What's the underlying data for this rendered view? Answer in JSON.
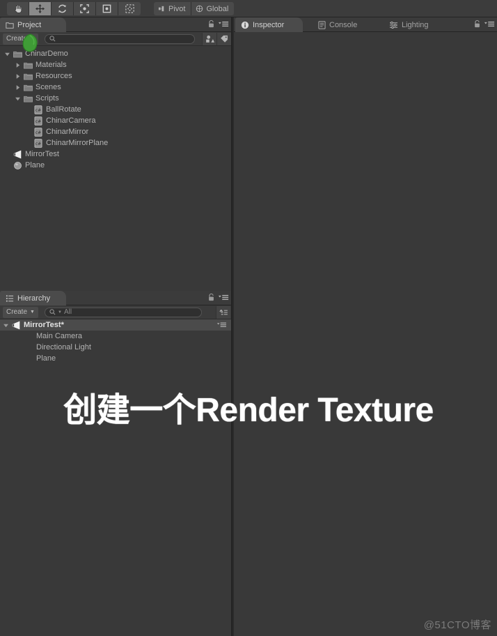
{
  "toolbar": {
    "tools": [
      {
        "name": "hand-tool",
        "icon": "hand-icon",
        "active": false
      },
      {
        "name": "move-tool",
        "icon": "move-icon",
        "active": true
      },
      {
        "name": "rotate-tool",
        "icon": "rotate-icon",
        "active": false
      },
      {
        "name": "scale-tool",
        "icon": "scale-icon",
        "active": false
      },
      {
        "name": "rect-tool",
        "icon": "rect-icon",
        "active": false
      },
      {
        "name": "transform-tool",
        "icon": "transform-icon",
        "active": false
      }
    ],
    "pivot_label": "Pivot",
    "global_label": "Global"
  },
  "project_panel": {
    "tab_label": "Project",
    "create_label": "Create",
    "search_placeholder": "",
    "tree": [
      {
        "label": "ChinarDemo",
        "depth": 0,
        "icon": "folder-icon",
        "arrow": "down",
        "selected": false
      },
      {
        "label": "Materials",
        "depth": 1,
        "icon": "folder-icon",
        "arrow": "right",
        "selected": false
      },
      {
        "label": "Resources",
        "depth": 1,
        "icon": "folder-icon",
        "arrow": "right",
        "selected": false
      },
      {
        "label": "Scenes",
        "depth": 1,
        "icon": "folder-icon",
        "arrow": "right",
        "selected": false
      },
      {
        "label": "Scripts",
        "depth": 1,
        "icon": "folder-icon",
        "arrow": "down",
        "selected": false
      },
      {
        "label": "BallRotate",
        "depth": 2,
        "icon": "csharp-script-icon",
        "arrow": "none",
        "selected": false
      },
      {
        "label": "ChinarCamera",
        "depth": 2,
        "icon": "csharp-script-icon",
        "arrow": "none",
        "selected": false
      },
      {
        "label": "ChinarMirror",
        "depth": 2,
        "icon": "csharp-script-icon",
        "arrow": "none",
        "selected": false
      },
      {
        "label": "ChinarMirrorPlane",
        "depth": 2,
        "icon": "csharp-script-icon",
        "arrow": "none",
        "selected": false
      },
      {
        "label": "MirrorTest",
        "depth": 0,
        "icon": "scene-icon",
        "arrow": "none",
        "selected": false
      },
      {
        "label": "Plane",
        "depth": 0,
        "icon": "prefab-icon",
        "arrow": "none",
        "selected": false
      }
    ]
  },
  "hierarchy_panel": {
    "tab_label": "Hierarchy",
    "create_label": "Create",
    "search_value": "All",
    "tree": [
      {
        "label": "MirrorTest*",
        "depth": 0,
        "icon": "scene-icon",
        "arrow": "down",
        "selected": true
      },
      {
        "label": "Main Camera",
        "depth": 1,
        "icon": "none",
        "arrow": "none",
        "selected": false
      },
      {
        "label": "Directional Light",
        "depth": 1,
        "icon": "none",
        "arrow": "none",
        "selected": false
      },
      {
        "label": "Plane",
        "depth": 1,
        "icon": "none",
        "arrow": "none",
        "selected": false
      }
    ]
  },
  "inspector_panel": {
    "tabs": [
      {
        "label": "Inspector",
        "icon": "info-icon",
        "active": true
      },
      {
        "label": "Console",
        "icon": "console-icon",
        "active": false
      },
      {
        "label": "Lighting",
        "icon": "lighting-icon",
        "active": false
      }
    ]
  },
  "overlay": {
    "text": "创建一个Render Texture",
    "watermark": "@51CTO博客"
  },
  "colors": {
    "panel_bg": "#393939",
    "toolbar_bg": "#3c3c3c",
    "tab_active_bg": "#4b4b4b",
    "text": "#b4b4b4",
    "cursor_green": "#3d9b35"
  }
}
